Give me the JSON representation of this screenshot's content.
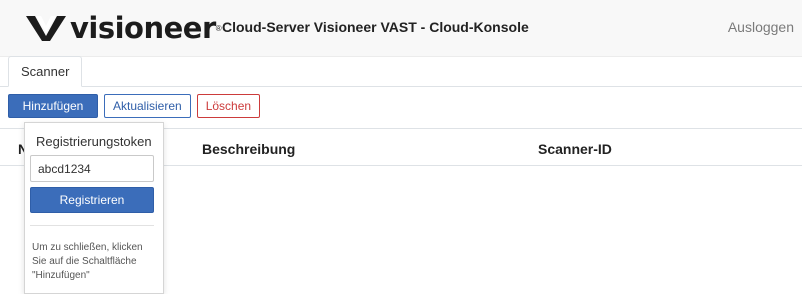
{
  "header": {
    "logo_text": "visioneer",
    "logo_reg": "®",
    "title": "Cloud-Server Visioneer VAST - Cloud-Konsole",
    "logout_label": "Ausloggen"
  },
  "tabs": [
    {
      "label": "Scanner",
      "active": true
    }
  ],
  "toolbar": {
    "add_label": "Hinzufügen",
    "refresh_label": "Aktualisieren",
    "delete_label": "Löschen"
  },
  "table": {
    "columns": [
      "N",
      "Beschreibung",
      "Scanner-ID"
    ]
  },
  "popover": {
    "title": "Registrierungstoken",
    "input_value": "abcd1234",
    "register_label": "Registrieren",
    "hint": "Um zu schließen, klicken Sie auf die Schaltfläche \"Hinzufügen\""
  },
  "colors": {
    "primary": "#3b6dba",
    "danger": "#cc3b3b",
    "header_bg": "#f8f8f8"
  }
}
